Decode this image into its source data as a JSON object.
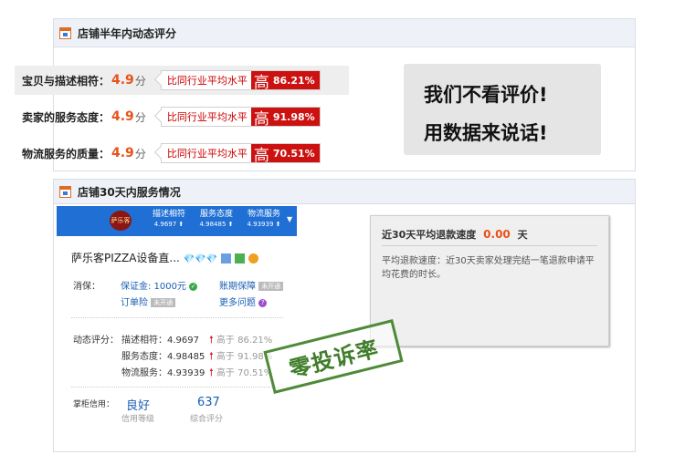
{
  "panel1": {
    "title": "店铺半年内动态评分",
    "rows": [
      {
        "label": "宝贝与描述相符：",
        "score": "4.9",
        "unit": "分",
        "compare": "比同行业平均水平",
        "level": "高",
        "pct": "86.21%"
      },
      {
        "label": "卖家的服务态度：",
        "score": "4.9",
        "unit": "分",
        "compare": "比同行业平均水平",
        "level": "高",
        "pct": "91.98%"
      },
      {
        "label": "物流服务的质量：",
        "score": "4.9",
        "unit": "分",
        "compare": "比同行业平均水平",
        "level": "高",
        "pct": "70.51%"
      }
    ],
    "slogan": [
      "我们不看评价!",
      "用数据来说话!"
    ]
  },
  "panel2": {
    "title": "店铺30天内服务情况",
    "shop_tabs": [
      {
        "label": "描述相符",
        "value": "4.9697"
      },
      {
        "label": "服务态度",
        "value": "4.98485"
      },
      {
        "label": "物流服务",
        "value": "4.93939"
      }
    ],
    "logo_text": "萨乐客",
    "shop_name": "萨乐客PIZZA设备直...",
    "guarantee_label": "消保：",
    "deposit": "保证金: 1000元",
    "account_period": "账期保障",
    "order_insurance": "订单险",
    "not_enabled": "未开通",
    "more_questions": "更多问题",
    "dynamic_label": "动态评分：",
    "ratings": [
      {
        "name": "描述相符：4.9697",
        "cmp": "高于 86.21%"
      },
      {
        "name": "服务态度：4.98485",
        "cmp": "高于 91.98%"
      },
      {
        "name": "物流服务：4.93939",
        "cmp": "高于 70.51%"
      }
    ],
    "credit_label": "掌柜信用：",
    "credit_value": "良好",
    "credit_level_label": "信用等级",
    "overall_value": "637",
    "overall_label": "综合评分",
    "refund_title": "近30天平均退款速度",
    "refund_value": "0.00",
    "refund_unit": "天",
    "refund_desc": "平均退款速度：近30天卖家处理完结一笔退款申请平均花费的时长。",
    "stamp": "零投诉率"
  },
  "colors": {
    "accent_red": "#cc1111",
    "score_orange": "#e8521a",
    "shop_blue": "#1f6fd4",
    "stamp_green": "#3f7d2a"
  }
}
